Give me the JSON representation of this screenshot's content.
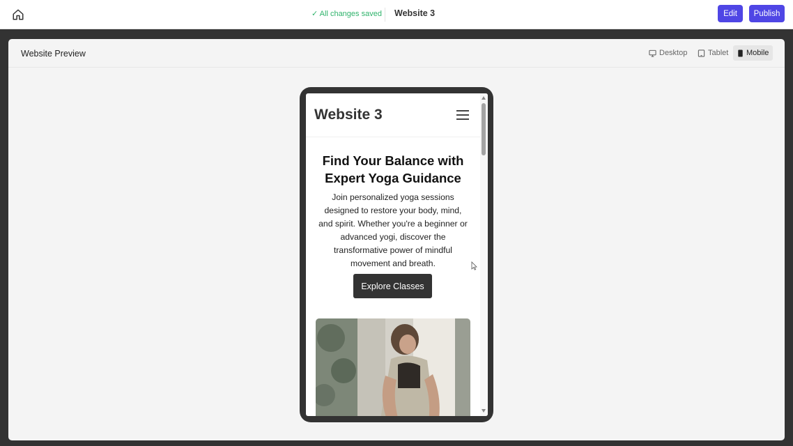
{
  "topbar": {
    "home_icon": "home-icon",
    "save_status": "✓ All changes saved",
    "site_title": "Website 3",
    "edit_label": "Edit",
    "publish_label": "Publish"
  },
  "preview": {
    "title": "Website Preview",
    "tabs": [
      {
        "label": "Desktop",
        "icon": "desktop-icon",
        "active": false
      },
      {
        "label": "Tablet",
        "icon": "tablet-icon",
        "active": false
      },
      {
        "label": "Mobile",
        "icon": "mobile-icon",
        "active": true
      }
    ]
  },
  "mobile_site": {
    "brand": "Website 3",
    "menu_icon": "hamburger-menu-icon",
    "hero_title": "Find Your Balance with Expert Yoga Guidance",
    "hero_text": "Join personalized yoga sessions designed to restore your body, mind, and spirit. Whether you're a beginner or advanced yogi, discover the transformative power of mindful movement and breath.",
    "cta_label": "Explore Classes",
    "hero_image": "yoga-woman-stretching-photo"
  },
  "colors": {
    "accent": "#4f46e5",
    "saved": "#2fb36b",
    "frame": "#333333"
  }
}
